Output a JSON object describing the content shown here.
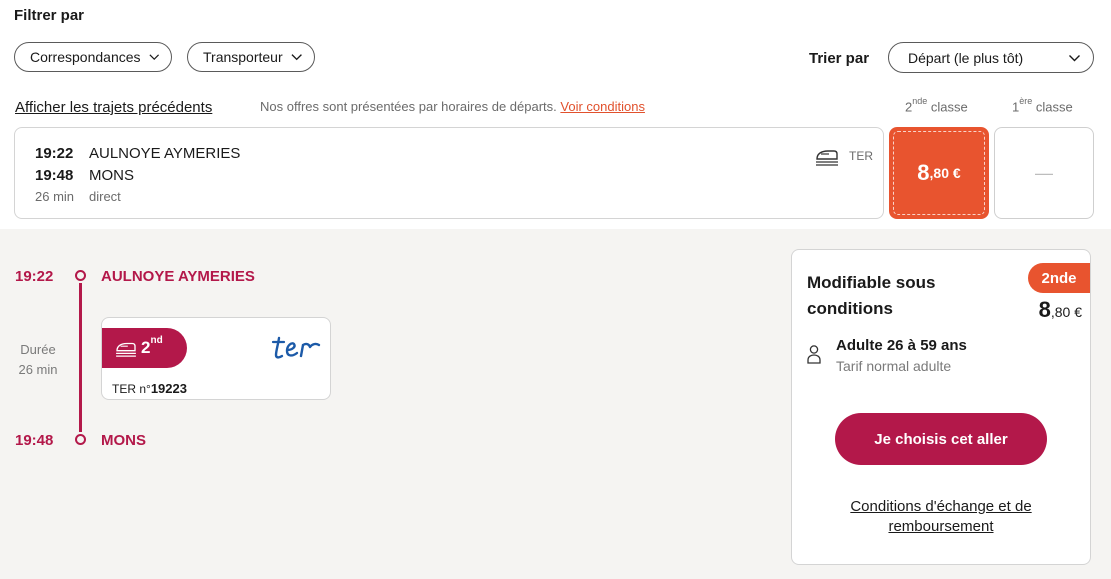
{
  "filters": {
    "title": "Filtrer par",
    "correspondances": "Correspondances",
    "transporteur": "Transporteur"
  },
  "sort": {
    "label": "Trier par",
    "value": "Départ (le plus tôt)"
  },
  "list_header": {
    "prev_link": "Afficher les trajets précédents",
    "offers_note": "Nos offres sont présentées par horaires de départs.",
    "conditions_link": "Voir conditions",
    "class2_num": "2",
    "class2_sup": "nde",
    "class2_word": "classe",
    "class1_num": "1",
    "class1_sup": "ère",
    "class1_word": "classe"
  },
  "journey": {
    "dep_time": "19:22",
    "dep_station": "AULNOYE AYMERIES",
    "arr_time": "19:48",
    "arr_station": "MONS",
    "duration": "26 min",
    "connection": "direct",
    "carrier": "TER",
    "price_2nd_int": "8",
    "price_2nd_dec": ",80 €",
    "price_1st": "—"
  },
  "details": {
    "dep_time": "19:22",
    "dep_station": "AULNOYE AYMERIES",
    "arr_time": "19:48",
    "arr_station": "MONS",
    "duration_label": "Durée",
    "duration_value": "26 min",
    "badge_num": "2",
    "badge_sup": "nd",
    "train_prefix": "TER n°",
    "train_number": "19223"
  },
  "fare": {
    "title": "Modifiable sous conditions",
    "class_tag": "2nde",
    "price_int": "8",
    "price_dec": ",80 €",
    "passenger": "Adulte 26 à 59 ans",
    "tarif": "Tarif normal adulte",
    "cta": "Je choisis cet aller",
    "conditions": "Conditions d'échange et de remboursement"
  },
  "colors": {
    "brand": "#b3184a",
    "accent_orange": "#e8542f",
    "panel_bg": "#f5f4f2"
  }
}
